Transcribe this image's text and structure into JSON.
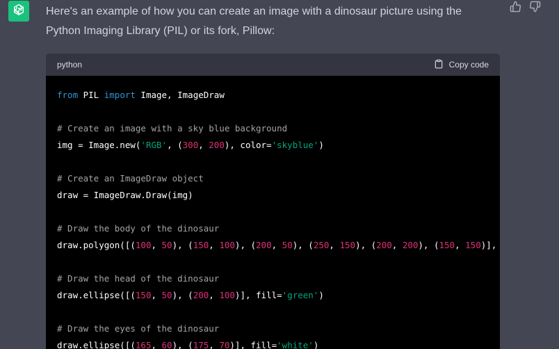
{
  "message": {
    "text": "Here's an example of how you can create an image with a dinosaur picture using the Python Imaging Library (PIL) or its fork, Pillow:"
  },
  "assistant_avatar_icon": "openai-logo-icon",
  "actions": {
    "like_icon": "thumbs-up-icon",
    "dislike_icon": "thumbs-down-icon"
  },
  "code_block": {
    "language": "python",
    "copy_label": "Copy code",
    "copy_icon": "clipboard-icon",
    "lines": [
      [
        {
          "t": "from",
          "c": "kw"
        },
        {
          "t": " PIL ",
          "c": ""
        },
        {
          "t": "import",
          "c": "kw"
        },
        {
          "t": " Image, ImageDraw",
          "c": ""
        }
      ],
      [],
      [
        {
          "t": "# Create an image with a sky blue background",
          "c": "cm"
        }
      ],
      [
        {
          "t": "img = Image.new(",
          "c": ""
        },
        {
          "t": "'RGB'",
          "c": "str"
        },
        {
          "t": ", (",
          "c": ""
        },
        {
          "t": "300",
          "c": "num"
        },
        {
          "t": ", ",
          "c": ""
        },
        {
          "t": "200",
          "c": "num"
        },
        {
          "t": "), color=",
          "c": ""
        },
        {
          "t": "'skyblue'",
          "c": "str"
        },
        {
          "t": ")",
          "c": ""
        }
      ],
      [],
      [
        {
          "t": "# Create an ImageDraw object",
          "c": "cm"
        }
      ],
      [
        {
          "t": "draw = ImageDraw.Draw(img)",
          "c": ""
        }
      ],
      [],
      [
        {
          "t": "# Draw the body of the dinosaur",
          "c": "cm"
        }
      ],
      [
        {
          "t": "draw.polygon([(",
          "c": ""
        },
        {
          "t": "100",
          "c": "num"
        },
        {
          "t": ", ",
          "c": ""
        },
        {
          "t": "50",
          "c": "num"
        },
        {
          "t": "), (",
          "c": ""
        },
        {
          "t": "150",
          "c": "num"
        },
        {
          "t": ", ",
          "c": ""
        },
        {
          "t": "100",
          "c": "num"
        },
        {
          "t": "), (",
          "c": ""
        },
        {
          "t": "200",
          "c": "num"
        },
        {
          "t": ", ",
          "c": ""
        },
        {
          "t": "50",
          "c": "num"
        },
        {
          "t": "), (",
          "c": ""
        },
        {
          "t": "250",
          "c": "num"
        },
        {
          "t": ", ",
          "c": ""
        },
        {
          "t": "150",
          "c": "num"
        },
        {
          "t": "), (",
          "c": ""
        },
        {
          "t": "200",
          "c": "num"
        },
        {
          "t": ", ",
          "c": ""
        },
        {
          "t": "200",
          "c": "num"
        },
        {
          "t": "), (",
          "c": ""
        },
        {
          "t": "150",
          "c": "num"
        },
        {
          "t": ", ",
          "c": ""
        },
        {
          "t": "150",
          "c": "num"
        },
        {
          "t": ")], fill='",
          "c": ""
        }
      ],
      [],
      [
        {
          "t": "# Draw the head of the dinosaur",
          "c": "cm"
        }
      ],
      [
        {
          "t": "draw.ellipse([(",
          "c": ""
        },
        {
          "t": "150",
          "c": "num"
        },
        {
          "t": ", ",
          "c": ""
        },
        {
          "t": "50",
          "c": "num"
        },
        {
          "t": "), (",
          "c": ""
        },
        {
          "t": "200",
          "c": "num"
        },
        {
          "t": ", ",
          "c": ""
        },
        {
          "t": "100",
          "c": "num"
        },
        {
          "t": ")], fill=",
          "c": ""
        },
        {
          "t": "'green'",
          "c": "str"
        },
        {
          "t": ")",
          "c": ""
        }
      ],
      [],
      [
        {
          "t": "# Draw the eyes of the dinosaur",
          "c": "cm"
        }
      ],
      [
        {
          "t": "draw.ellipse([(",
          "c": ""
        },
        {
          "t": "165",
          "c": "num"
        },
        {
          "t": ", ",
          "c": ""
        },
        {
          "t": "60",
          "c": "num"
        },
        {
          "t": "), (",
          "c": ""
        },
        {
          "t": "175",
          "c": "num"
        },
        {
          "t": ", ",
          "c": ""
        },
        {
          "t": "70",
          "c": "num"
        },
        {
          "t": ")], fill=",
          "c": ""
        },
        {
          "t": "'white'",
          "c": "str"
        },
        {
          "t": ")",
          "c": ""
        }
      ]
    ]
  },
  "colors": {
    "page_bg": "#444654",
    "avatar_bg": "#19c37d",
    "code_bg": "#000000",
    "code_header_bg": "#343541",
    "keyword": "#2e95d3",
    "comment": "#a4a4a4",
    "number": "#df3079",
    "string": "#00a67d"
  }
}
